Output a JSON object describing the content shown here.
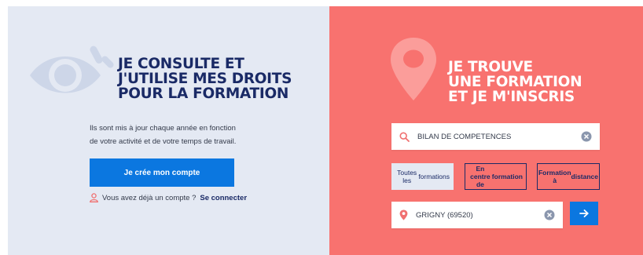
{
  "colors": {
    "left_panel_bg": "#e4e9f3",
    "right_panel_bg": "#f8726f",
    "navy": "#1a2a66",
    "primary_blue": "#0b77e0",
    "icon_red": "#f07070"
  },
  "left": {
    "heading_lines": [
      "JE CONSULTE ET",
      "J'UTILISE MES DROITS",
      "POUR LA FORMATION"
    ],
    "description_lines": [
      "Ils sont mis à jour chaque année en fonction",
      "de votre activité et de votre temps de travail."
    ],
    "create_account_label": "Je crée mon compte",
    "have_account_text": "Vous avez déjà un compte ?",
    "login_link_label": "Se connecter",
    "icons": {
      "hero": "eye-icon",
      "login": "user-icon"
    }
  },
  "right": {
    "heading_lines": [
      "JE TROUVE",
      "UNE FORMATION",
      "ET JE M'INSCRIS"
    ],
    "search": {
      "value": "BILAN DE COMPETENCES",
      "placeholder": ""
    },
    "filters": [
      {
        "label_lines": [
          "Toutes les",
          "formations"
        ],
        "active": true
      },
      {
        "label_lines": [
          "En centre de",
          "formation"
        ],
        "active": false
      },
      {
        "label_lines": [
          "Formation à",
          "distance"
        ],
        "active": false
      }
    ],
    "location": {
      "value": "GRIGNY (69520)",
      "placeholder": ""
    },
    "icons": {
      "hero": "map-pin-icon",
      "search": "search-icon",
      "clear": "clear-icon",
      "location": "location-pin-icon",
      "submit": "arrow-right-icon"
    }
  }
}
